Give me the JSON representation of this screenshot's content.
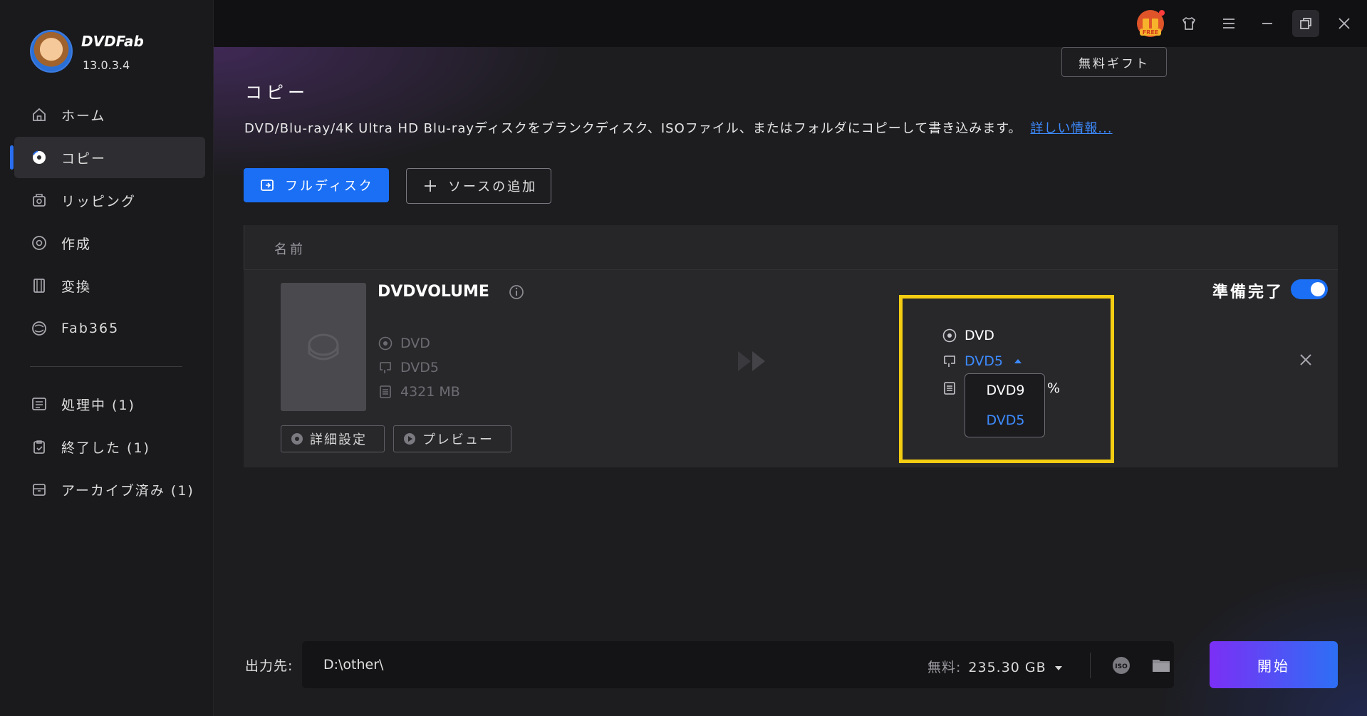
{
  "app": {
    "name": "DVDFab",
    "version": "13.0.3.4"
  },
  "sidebar": {
    "items": [
      {
        "label": "ホーム",
        "icon": "home-icon"
      },
      {
        "label": "コピー",
        "icon": "copy-disc-icon",
        "active": true
      },
      {
        "label": "リッピング",
        "icon": "ripper-icon"
      },
      {
        "label": "作成",
        "icon": "creator-icon"
      },
      {
        "label": "変換",
        "icon": "film-convert-icon"
      },
      {
        "label": "Fab365",
        "icon": "fab365-icon"
      }
    ],
    "queues": [
      {
        "label": "処理中 (1)",
        "icon": "processing-list-icon"
      },
      {
        "label": "終了した (1)",
        "icon": "finished-clipboard-icon"
      },
      {
        "label": "アーカイブ済み (1)",
        "icon": "archive-box-icon"
      }
    ]
  },
  "titlebar": {
    "gift_badge": "FREE",
    "free_gift_label": "無料ギフト"
  },
  "page": {
    "title": "コピー",
    "description": "DVD/Blu-ray/4K Ultra HD Blu-rayディスクをブランクディスク、ISOファイル、またはフォルダにコピーして書き込みます。",
    "more_link": "詳しい情報..."
  },
  "toolbar": {
    "full_disc_label": "フルディスク",
    "add_source_label": "ソースの追加"
  },
  "table": {
    "header_name": "名前",
    "row": {
      "title": "DVDVOLUME",
      "source": {
        "type": "DVD",
        "disc": "DVD5",
        "size": "4321 MB"
      },
      "settings_label": "詳細設定",
      "preview_label": "プレビュー",
      "target": {
        "type": "DVD",
        "disc": "DVD5",
        "percent_suffix": "%"
      },
      "dropdown_options": [
        "DVD9",
        "DVD5"
      ],
      "dropdown_selected": "DVD5",
      "status_label": "準備完了",
      "ready_toggle_on": true
    }
  },
  "output": {
    "label": "出力先:",
    "path": "D:\\other\\",
    "free_label": "無料:",
    "free_value": "235.30 GB",
    "start_label": "開始"
  },
  "colors": {
    "accent": "#1a6ff5",
    "highlight": "#f4cc12",
    "link": "#3d8bff",
    "start_gradient_from": "#7b2ff5",
    "start_gradient_to": "#2d6ff5"
  }
}
